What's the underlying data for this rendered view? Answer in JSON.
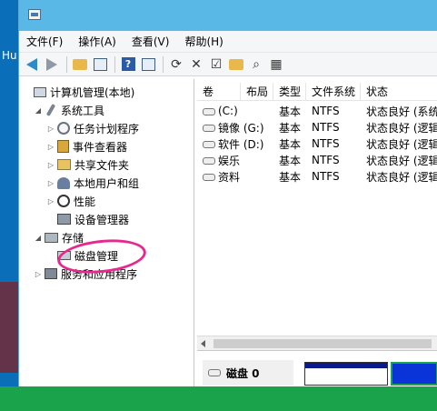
{
  "desktop": {
    "side_text": "Hu"
  },
  "menu": [
    "文件(F)",
    "操作(A)",
    "查看(V)",
    "帮助(H)"
  ],
  "tree": [
    {
      "label": "计算机管理(本地)",
      "level": 0,
      "expand": ""
    },
    {
      "label": "系统工具",
      "level": 1,
      "expand": "◢"
    },
    {
      "label": "任务计划程序",
      "level": 2,
      "expand": "▷"
    },
    {
      "label": "事件查看器",
      "level": 2,
      "expand": "▷"
    },
    {
      "label": "共享文件夹",
      "level": 2,
      "expand": "▷"
    },
    {
      "label": "本地用户和组",
      "level": 2,
      "expand": "▷"
    },
    {
      "label": "性能",
      "level": 2,
      "expand": "▷"
    },
    {
      "label": "设备管理器",
      "level": 2,
      "expand": ""
    },
    {
      "label": "存储",
      "level": 1,
      "expand": "◢"
    },
    {
      "label": "磁盘管理",
      "level": 2,
      "expand": ""
    },
    {
      "label": "服务和应用程序",
      "level": 1,
      "expand": "▷"
    }
  ],
  "volume_table": {
    "columns": [
      "卷",
      "布局",
      "类型",
      "文件系统",
      "状态"
    ],
    "rows": [
      [
        "(C:)",
        "",
        "基本",
        "NTFS",
        "状态良好 (系统"
      ],
      [
        "镜像 (G:)",
        "",
        "基本",
        "NTFS",
        "状态良好 (逻辑"
      ],
      [
        "软件 (D:)",
        "",
        "基本",
        "NTFS",
        "状态良好 (逻辑"
      ],
      [
        "娱乐",
        "",
        "基本",
        "NTFS",
        "状态良好 (逻辑"
      ],
      [
        "资料",
        "",
        "基本",
        "NTFS",
        "状态良好 (逻辑"
      ]
    ]
  },
  "disk_panel": {
    "disk_label": "磁盘 0"
  },
  "colors": {
    "titlebar": "#5ab8e6",
    "annotation": "#e8278f",
    "partition_primary": "#0a1a8a",
    "partition_logical": "#0b34d8"
  }
}
